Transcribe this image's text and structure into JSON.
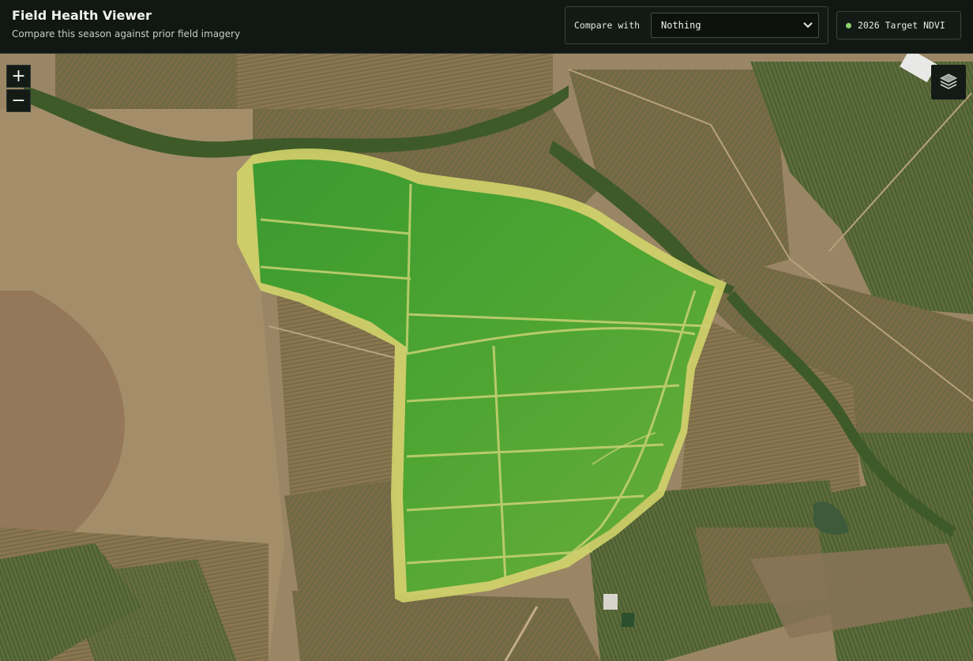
{
  "header": {
    "title": "Field Health Viewer",
    "subtitle": "Compare this season against prior field imagery"
  },
  "compare": {
    "label": "Compare with",
    "selected": "Nothing"
  },
  "target": {
    "label": "2026 Target NDVI",
    "dot_color": "#8ed26a"
  },
  "map_controls": {
    "zoom_in": "+",
    "zoom_out": "−",
    "layers_icon": "layers-icon"
  },
  "colors": {
    "header_bg": "#111814",
    "ndvi_high": "#3f9a32",
    "ndvi_low": "#d9d86a"
  }
}
